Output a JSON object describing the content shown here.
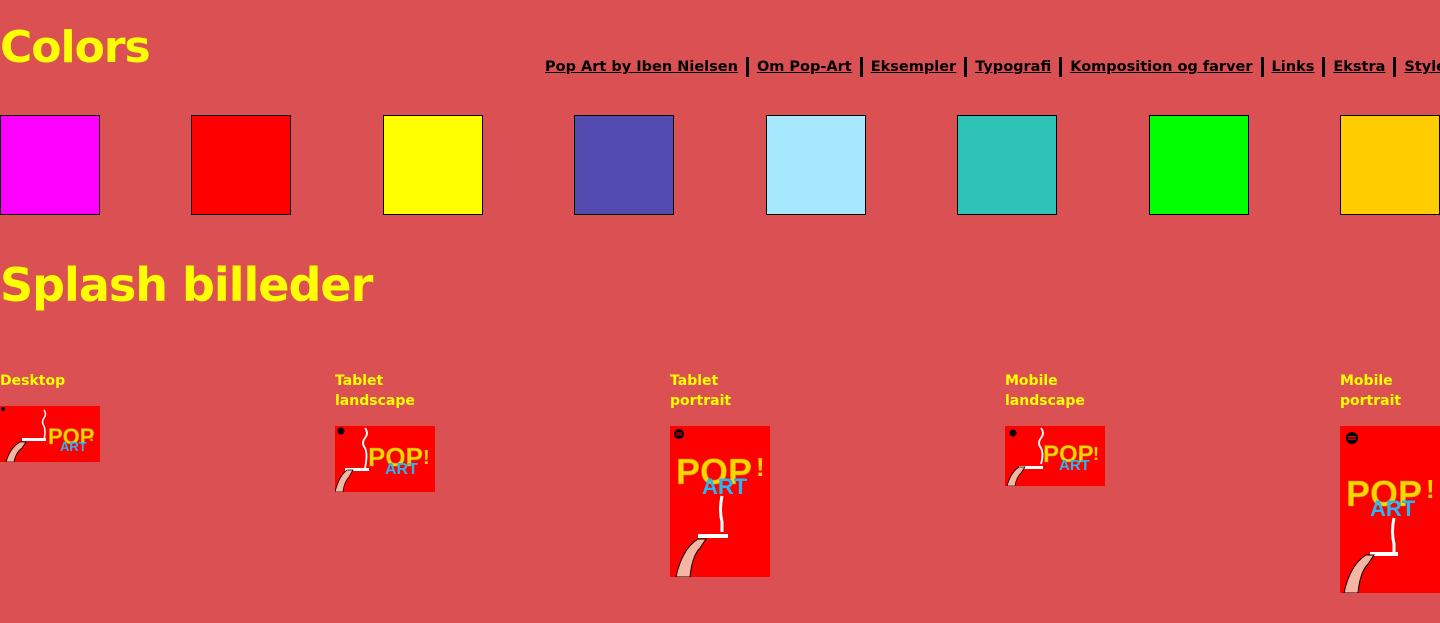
{
  "headings": {
    "colors": "Colors",
    "splash": "Splash billeder"
  },
  "nav": {
    "items": [
      {
        "label": "Pop Art by Iben Nielsen"
      },
      {
        "label": "Om Pop-Art"
      },
      {
        "label": "Eksempler"
      },
      {
        "label": "Typografi"
      },
      {
        "label": "Komposition og farver"
      },
      {
        "label": "Links"
      },
      {
        "label": "Ekstra"
      },
      {
        "label": "Styletile"
      }
    ]
  },
  "swatches": [
    "#ff00ff",
    "#ff0000",
    "#ffff00",
    "#534baf",
    "#a6e9ff",
    "#2fc3b7",
    "#00ff00",
    "#ffcc00"
  ],
  "splash": [
    {
      "label": "Desktop"
    },
    {
      "label": "Tablet landscape"
    },
    {
      "label": "Tablet portrait"
    },
    {
      "label": "Mobile landscape"
    },
    {
      "label": "Mobile portrait"
    }
  ],
  "artwork": {
    "pop": "POP",
    "art": "ART",
    "exclaim": "!"
  }
}
